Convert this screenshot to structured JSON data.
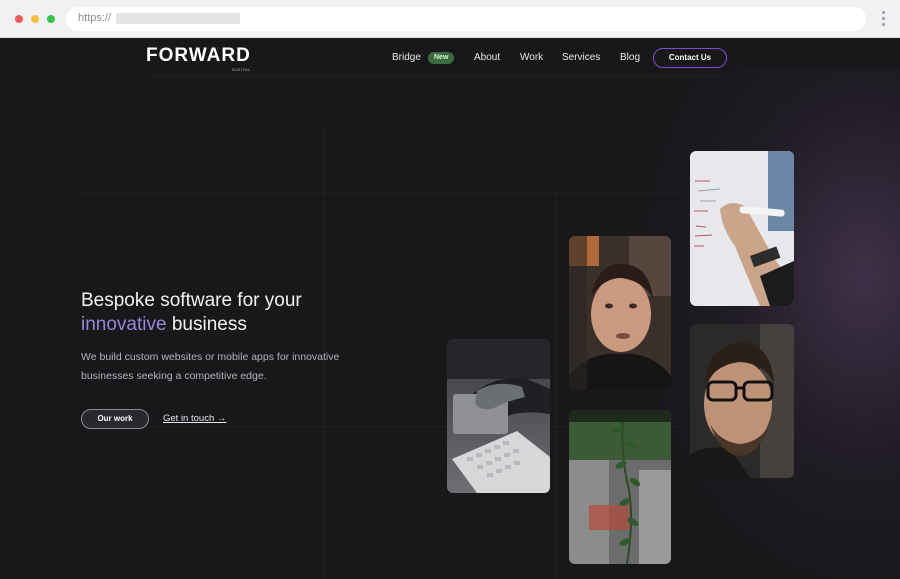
{
  "browser": {
    "url_prefix": "https://"
  },
  "brand": {
    "name": "FORWARD",
    "sub": "DIGITAL"
  },
  "nav": {
    "items": [
      {
        "label": "Bridge"
      },
      {
        "label": "About"
      },
      {
        "label": "Work"
      },
      {
        "label": "Services"
      },
      {
        "label": "Blog"
      }
    ],
    "badge": "New",
    "contact": "Contact Us"
  },
  "hero": {
    "headline_line1": "Bespoke software for your",
    "headline_accent": "innovative",
    "headline_line2_rest": " business",
    "subheadline": "We build custom websites or mobile apps for innovative businesses seeking a competitive edge.",
    "primary_cta": "Our work",
    "secondary_cta": "Get in touch →"
  },
  "colors": {
    "background": "#18171a",
    "accent": "#9a86d8",
    "contact_border": "#7a4fd0",
    "badge": "#3b6b3e"
  }
}
